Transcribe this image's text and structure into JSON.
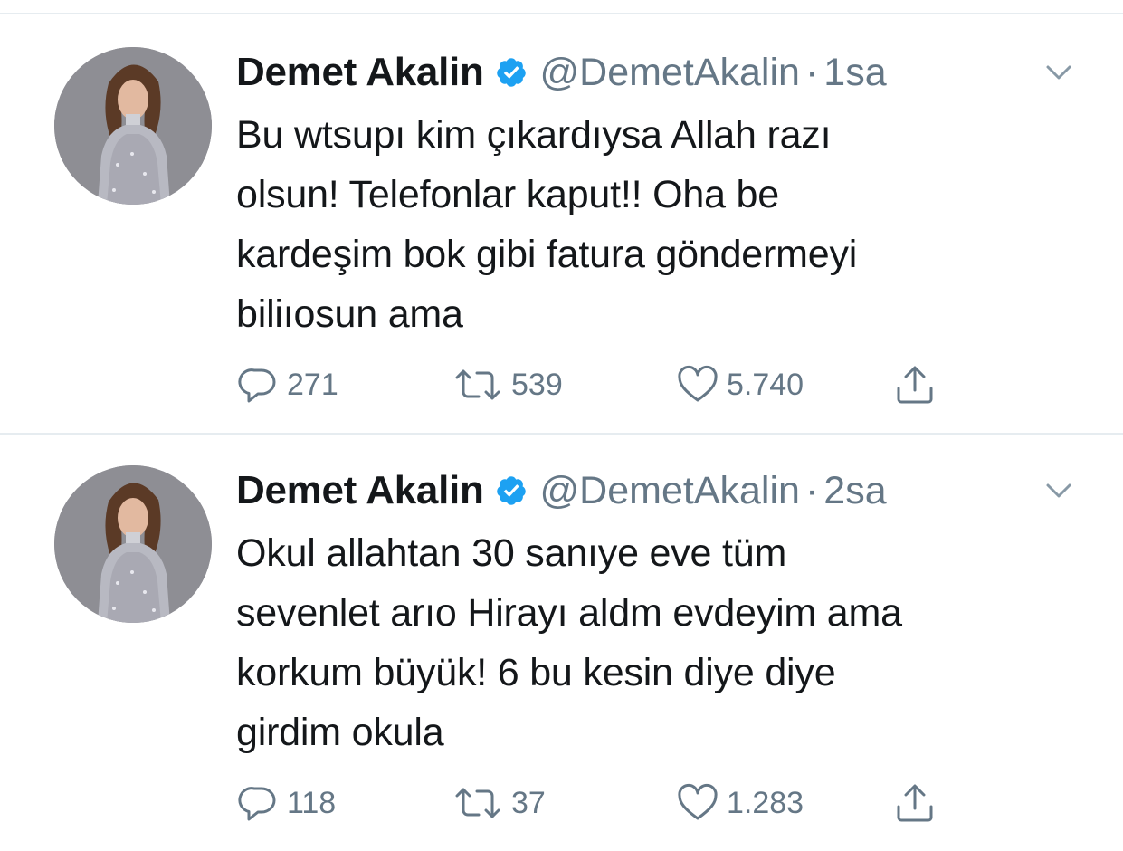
{
  "colors": {
    "text": "#14171a",
    "secondary": "#657786",
    "verified": "#1da1f2",
    "divider": "#e6ecf0"
  },
  "tweets": [
    {
      "author_name": "Demet Akalin",
      "handle": "@DemetAkalin",
      "separator": "·",
      "time": "1sa",
      "lines": [
        "Bu wtsupı kim çıkardıysa Allah razı",
        "olsun! Telefonlar kaput!! Oha be",
        "kardeşim bok gibi fatura göndermeyi",
        "biliıosun ama"
      ],
      "replies": "271",
      "retweets": "539",
      "likes": "5.740"
    },
    {
      "author_name": "Demet Akalin",
      "handle": "@DemetAkalin",
      "separator": "·",
      "time": "2sa",
      "lines": [
        "Okul allahtan 30 sanıye eve tüm",
        "sevenlet arıo Hirayı aldm evdeyim ama",
        "korkum büyük! 6 bu kesin diye diye",
        "girdim okula"
      ],
      "replies": "118",
      "retweets": "37",
      "likes": "1.283"
    }
  ]
}
